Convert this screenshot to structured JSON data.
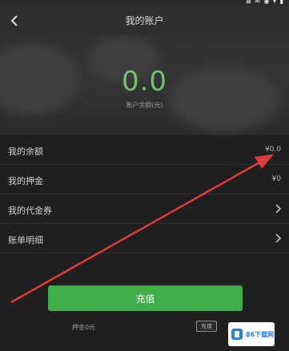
{
  "status_bar": {
    "icons": "⊠ ✉ ◉ ▾ ▮"
  },
  "header": {
    "title": "我的账户"
  },
  "balance": {
    "amount": "0.0",
    "label": "账户余额(元)"
  },
  "rows": [
    {
      "label": "我的余额",
      "value": "¥0.0",
      "type": "value"
    },
    {
      "label": "我的押金",
      "value": "¥0",
      "type": "value"
    },
    {
      "label": "我的代金券",
      "type": "chevron"
    },
    {
      "label": "账单明细",
      "type": "chevron"
    }
  ],
  "recharge": {
    "label": "充值"
  },
  "deposit": {
    "note": "押金0元",
    "tag": "充值"
  },
  "watermark": {
    "text": "86下载网"
  },
  "colors": {
    "accent": "#3fae4a",
    "balance_green": "#6fc26f",
    "annotation_red": "#e23a3a"
  }
}
